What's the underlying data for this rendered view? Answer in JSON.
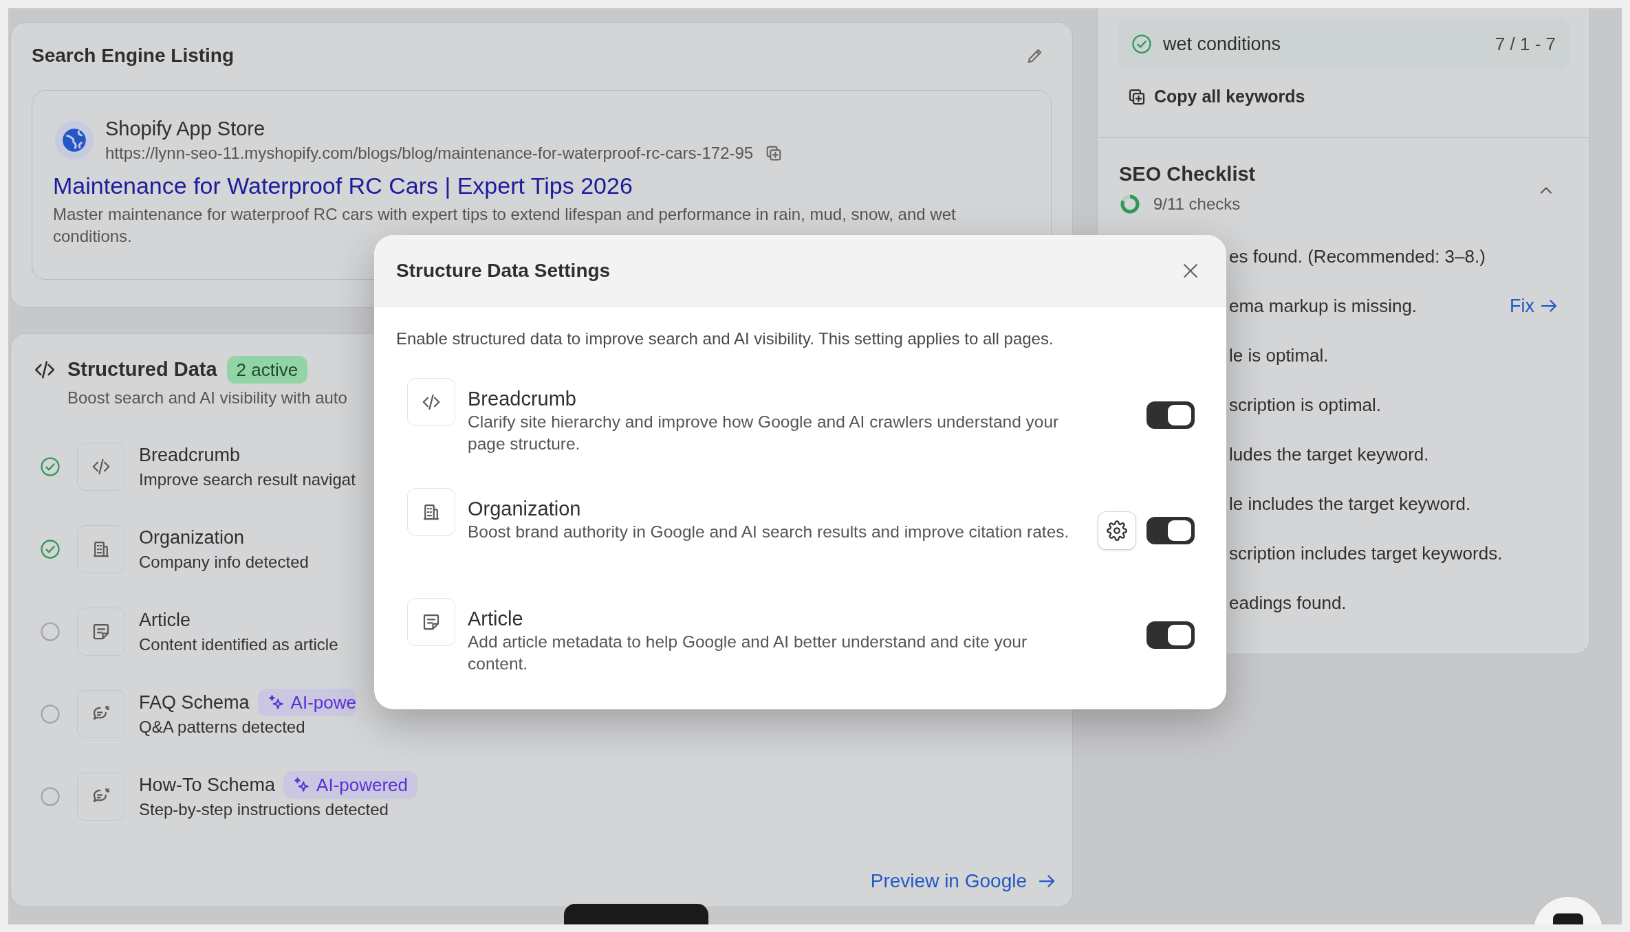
{
  "search_listing": {
    "title": "Search Engine Listing",
    "site_name": "Shopify App Store",
    "url": "https://lynn-seo-11.myshopify.com/blogs/blog/maintenance-for-waterproof-rc-cars-172-95",
    "page_title": "Maintenance for Waterproof RC Cars | Expert Tips 2026",
    "description": "Master maintenance for waterproof RC cars with expert tips to extend lifespan and performance in rain, mud, snow, and wet conditions."
  },
  "structured_data": {
    "title": "Structured Data",
    "badge": "2 active",
    "subtitle": "Boost search and AI visibility with auto",
    "items": [
      {
        "kind": "code",
        "title": "Breadcrumb",
        "description": "Improve search result navigat",
        "checked": true
      },
      {
        "kind": "building",
        "title": "Organization",
        "description": "Company info detected",
        "checked": true
      },
      {
        "kind": "note",
        "title": "Article",
        "description": "Content identified as article",
        "checked": false
      },
      {
        "kind": "chat",
        "title": "FAQ Schema",
        "badge": "AI-powe",
        "description": "Q&A patterns detected",
        "checked": false
      },
      {
        "kind": "chat",
        "title": "How-To Schema",
        "badge": "AI-powered",
        "description": "Step-by-step instructions detected",
        "checked": false
      }
    ],
    "preview_link": "Preview in Google"
  },
  "keywords": {
    "keyword": "wet conditions",
    "count": "7 / 1 - 7",
    "copy_label": "Copy all keywords"
  },
  "seo_checklist": {
    "title": "SEO Checklist",
    "progress": "9/11 checks",
    "level": 0.82,
    "expanded": true,
    "items": [
      {
        "text": "es found. (Recommended: 3–8.)"
      },
      {
        "text": "ema markup is missing.",
        "action": "Fix"
      },
      {
        "text": "le is optimal."
      },
      {
        "text": "scription is optimal."
      },
      {
        "text": "ludes the target keyword."
      },
      {
        "text": "le includes the target keyword."
      },
      {
        "text": "scription includes target keywords."
      },
      {
        "text": "eadings found."
      }
    ]
  },
  "modal": {
    "title": "Structure Data Settings",
    "description": "Enable structured data to improve search and AI visibility. This setting applies to all pages.",
    "items": [
      {
        "kind": "code",
        "title": "Breadcrumb",
        "description": "Clarify site hierarchy and improve how Google and AI crawlers understand your page structure.",
        "settings": false,
        "on": true
      },
      {
        "kind": "building",
        "title": "Organization",
        "description": "Boost brand authority in Google and AI search results and improve citation rates.",
        "settings": true,
        "on": true
      },
      {
        "kind": "note",
        "title": "Article",
        "description": "Add article metadata to help Google and AI better understand and cite your content.",
        "settings": false,
        "on": true
      }
    ]
  }
}
